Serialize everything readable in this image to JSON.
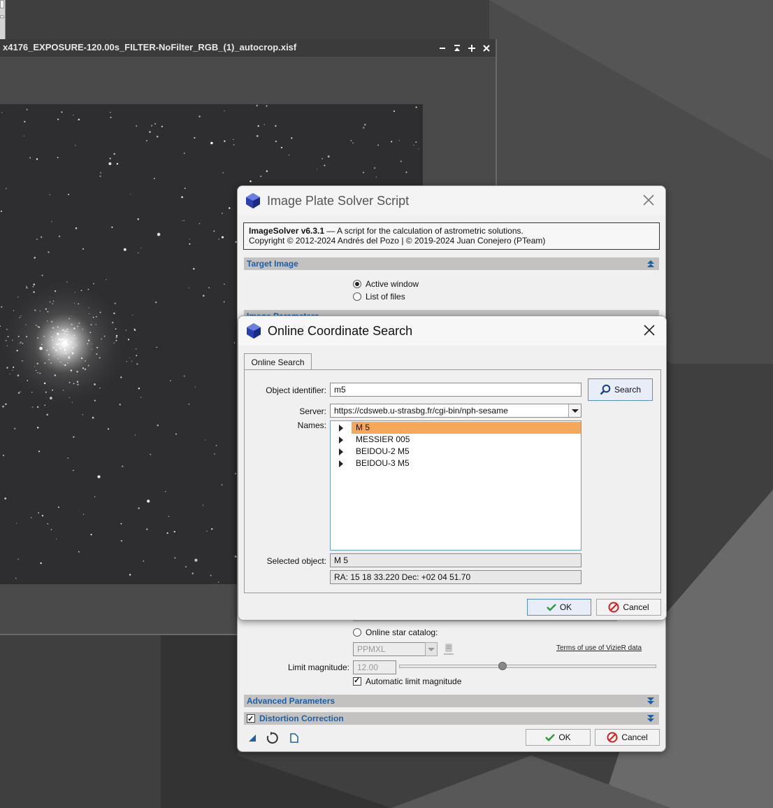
{
  "image_window": {
    "title": "x4176_EXPOSURE-120.00s_FILTER-NoFilter_RGB_(1)_autocrop.xisf",
    "controls": [
      "minimize-icon",
      "shade-icon",
      "maximize-icon",
      "close-icon"
    ]
  },
  "plate_solver": {
    "title": "Image Plate Solver Script",
    "info_name": "ImageSolver v6.3.1",
    "info_desc": " — A script for the calculation of astrometric solutions.",
    "info_copyright": "Copyright © 2012-2024 Andrés del Pozo | © 2019-2024 Juan Conejero (PTeam)",
    "target_image_label": "Target Image",
    "active_window_label": "Active window",
    "list_of_files_label": "List of files",
    "image_parameters_label": "Image Parameters",
    "online_star_catalog_label": "Online star catalog:",
    "catalog_value": "PPMXL",
    "terms_link": "Terms of use of VizieR data",
    "limit_magnitude_label": "Limit magnitude:",
    "limit_magnitude_value": "12.00",
    "limit_magnitude_slider_fraction": 0.4,
    "automatic_limit_label": "Automatic limit magnitude",
    "advanced_parameters_label": "Advanced Parameters",
    "distortion_correction_label": "Distortion Correction",
    "ok_label": "OK",
    "cancel_label": "Cancel"
  },
  "coord_search": {
    "title": "Online Coordinate Search",
    "tab_label": "Online Search",
    "object_identifier_label": "Object identifier:",
    "object_identifier_value": "m5",
    "search_label": "Search",
    "server_label": "Server:",
    "server_value": "https://cdsweb.u-strasbg.fr/cgi-bin/nph-sesame",
    "names_label": "Names:",
    "names": [
      "M 5",
      "MESSIER 005",
      "BEIDOU-2 M5",
      "BEIDOU-3 M5"
    ],
    "selected_object_label": "Selected object:",
    "selected_object_value": "M 5",
    "coordinates_value": "RA: 15 18 33.220  Dec: +02 04 51.70",
    "ok_label": "OK",
    "cancel_label": "Cancel"
  },
  "colors": {
    "accent": "#1b5fa8",
    "selection": "#f6a85a",
    "section_bar": "#c4c2c0",
    "ok_check": "#2e9a3e",
    "cancel_red": "#d02020"
  }
}
